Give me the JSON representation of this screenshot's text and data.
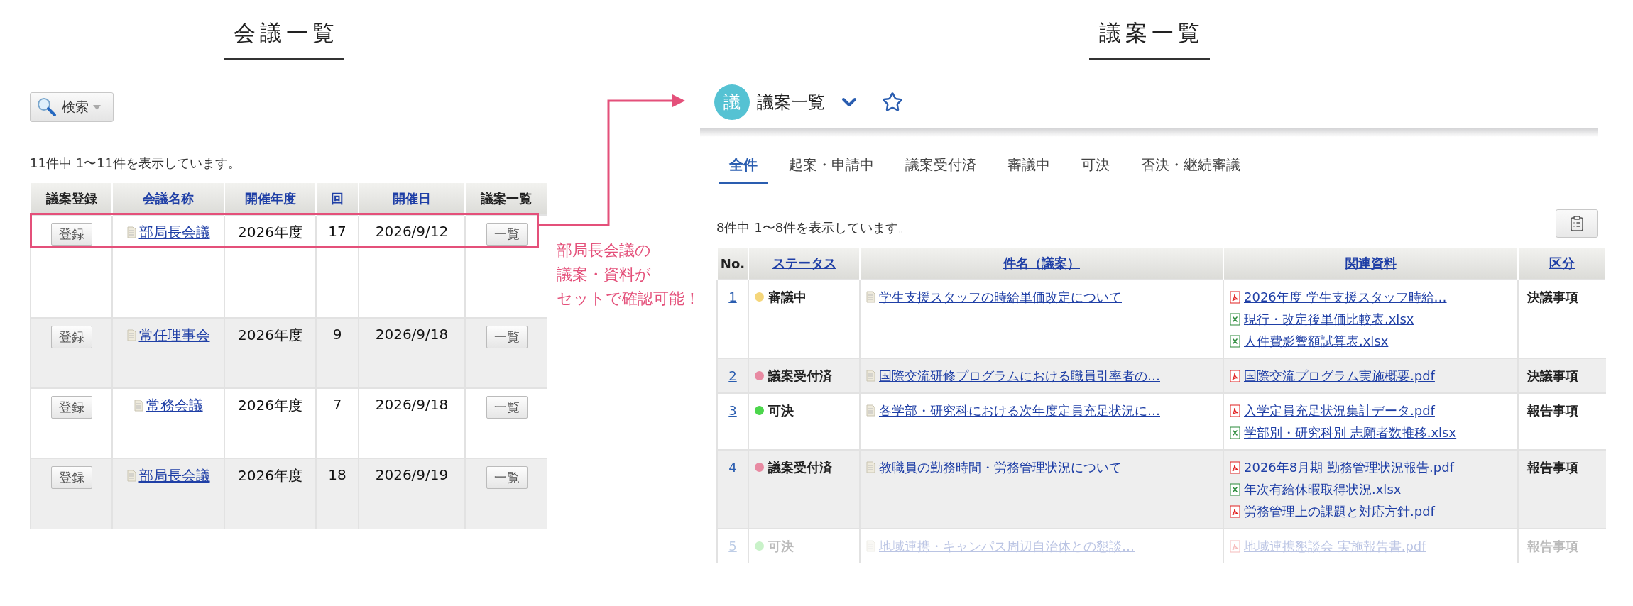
{
  "left_panel": {
    "heading": "会議一覧",
    "search_button": "検索",
    "result_count": "11件中 1〜11件を表示しています。",
    "table": {
      "columns": [
        {
          "label": "議案登録",
          "link": false
        },
        {
          "label": "会議名称",
          "link": true
        },
        {
          "label": "開催年度",
          "link": true
        },
        {
          "label": "回",
          "link": true
        },
        {
          "label": "開催日",
          "link": true
        },
        {
          "label": "議案一覧",
          "link": false
        }
      ],
      "rows": [
        {
          "register": "登録",
          "name": "部局長会議",
          "year": "2026年度",
          "round": "17",
          "date": "2026/9/12",
          "list": "一覧",
          "highlighted": true
        },
        {
          "register": "登録",
          "name": "常任理事会",
          "year": "2026年度",
          "round": "9",
          "date": "2026/9/18",
          "list": "一覧",
          "highlighted": false
        },
        {
          "register": "登録",
          "name": "常務会議",
          "year": "2026年度",
          "round": "7",
          "date": "2026/9/18",
          "list": "一覧",
          "highlighted": false
        },
        {
          "register": "登録",
          "name": "部局長会議",
          "year": "2026年度",
          "round": "18",
          "date": "2026/9/19",
          "list": "一覧",
          "highlighted": false
        }
      ]
    }
  },
  "callout": {
    "lines": [
      "部局長会議の",
      "議案・資料が",
      "セットで確認可能！"
    ]
  },
  "right_panel": {
    "heading": "議案一覧",
    "app_icon": "議",
    "app_title": "議案一覧",
    "tabs": [
      {
        "label": "全件",
        "selected": true
      },
      {
        "label": "起案・申請中",
        "selected": false
      },
      {
        "label": "議案受付済",
        "selected": false
      },
      {
        "label": "審議中",
        "selected": false
      },
      {
        "label": "可決",
        "selected": false
      },
      {
        "label": "否決・継続審議",
        "selected": false
      }
    ],
    "result_count": "8件中 1〜8件を表示しています。",
    "table": {
      "columns": [
        {
          "label": "No.",
          "link": false
        },
        {
          "label": "ステータス",
          "link": true
        },
        {
          "label": "件名（議案）",
          "link": true
        },
        {
          "label": "関連資料",
          "link": true
        },
        {
          "label": "区分",
          "link": true
        }
      ],
      "rows": [
        {
          "no": "1",
          "status": "審議中",
          "color": "#f5d67a",
          "subject": "学生支援スタッフの時給単価改定について",
          "files": [
            {
              "name": "2026年度 学生支援スタッフ時給…",
              "kind": "pdf"
            },
            {
              "name": "現行・改定後単価比較表.xlsx",
              "kind": "xlsx"
            },
            {
              "name": "人件費影響額試算表.xlsx",
              "kind": "xlsx"
            }
          ],
          "category": "決議事項",
          "faded": false
        },
        {
          "no": "2",
          "status": "議案受付済",
          "color": "#e88aa2",
          "subject": "国際交流研修プログラムにおける職員引率者の…",
          "files": [
            {
              "name": "国際交流プログラム実施概要.pdf",
              "kind": "pdf"
            }
          ],
          "category": "決議事項",
          "faded": false
        },
        {
          "no": "3",
          "status": "可決",
          "color": "#4cd64c",
          "subject": "各学部・研究科における次年度定員充足状況に…",
          "files": [
            {
              "name": "入学定員充足状況集計データ.pdf",
              "kind": "pdf"
            },
            {
              "name": "学部別・研究科別 志願者数推移.xlsx",
              "kind": "xlsx"
            }
          ],
          "category": "報告事項",
          "faded": false
        },
        {
          "no": "4",
          "status": "議案受付済",
          "color": "#e88aa2",
          "subject": "教職員の勤務時間・労務管理状況について",
          "files": [
            {
              "name": "2026年8月期 勤務管理状況報告.pdf",
              "kind": "pdf"
            },
            {
              "name": "年次有給休暇取得状況.xlsx",
              "kind": "xlsx"
            },
            {
              "name": "労務管理上の課題と対応方針.pdf",
              "kind": "pdf"
            }
          ],
          "category": "報告事項",
          "faded": false
        },
        {
          "no": "5",
          "status": "可決",
          "color": "#c9f2c9",
          "subject": "地域連携・キャンパス周辺自治体との懇談…",
          "files": [
            {
              "name": "地域連携懇談会 実施報告書.pdf",
              "kind": "pdf"
            }
          ],
          "category": "報告事項",
          "faded": true
        }
      ]
    }
  }
}
